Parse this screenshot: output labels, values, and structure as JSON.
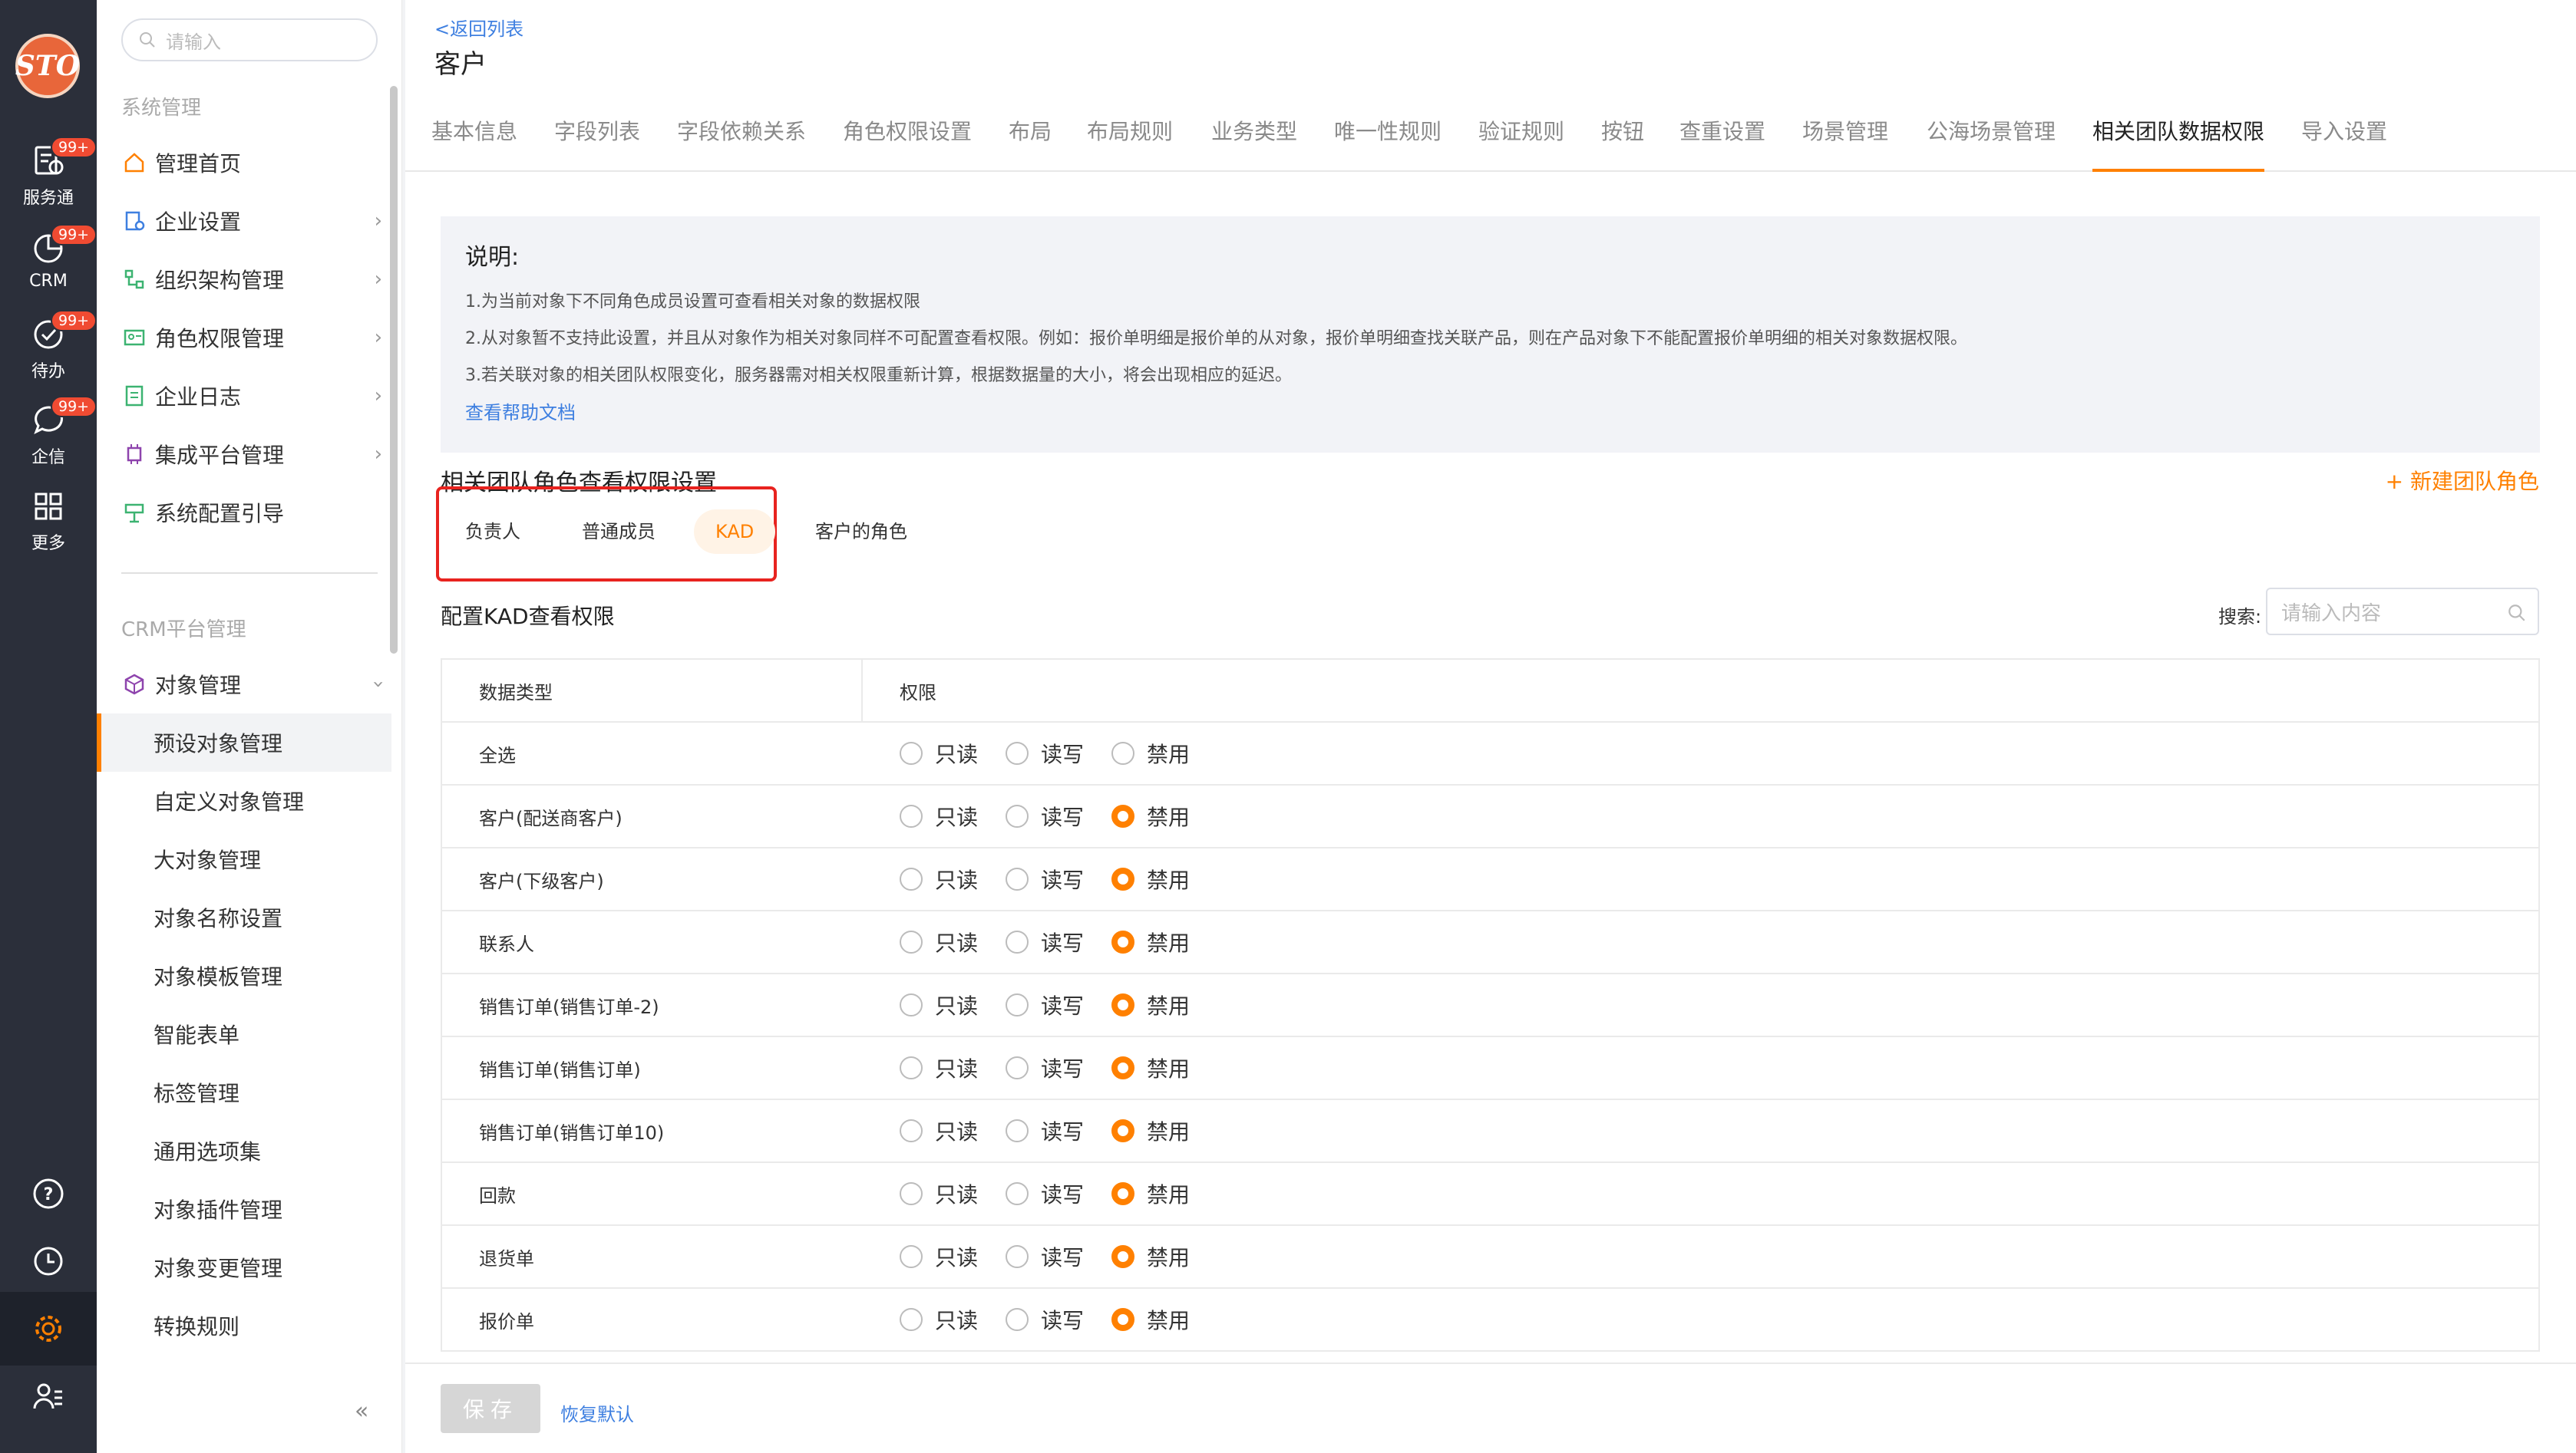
{
  "rail": {
    "logo": "STO",
    "items": [
      {
        "label": "服务通",
        "badge": "99+",
        "icon": "service-icon"
      },
      {
        "label": "CRM",
        "badge": "99+",
        "icon": "crm-icon"
      },
      {
        "label": "待办",
        "badge": "99+",
        "icon": "todo-icon"
      },
      {
        "label": "企信",
        "badge": "99+",
        "icon": "chat-icon"
      },
      {
        "label": "更多",
        "icon": "grid-icon"
      }
    ],
    "bottom": [
      "help-icon",
      "clock-icon",
      "gear-icon",
      "user-settings-icon"
    ]
  },
  "sidebar": {
    "search_placeholder": "请输入",
    "section1": "系统管理",
    "items": [
      {
        "label": "管理首页",
        "icon": "home-icon"
      },
      {
        "label": "企业设置",
        "icon": "company-icon"
      },
      {
        "label": "组织架构管理",
        "icon": "org-icon"
      },
      {
        "label": "角色权限管理",
        "icon": "role-icon"
      },
      {
        "label": "企业日志",
        "icon": "log-icon"
      },
      {
        "label": "集成平台管理",
        "icon": "chip-icon"
      },
      {
        "label": "系统配置引导",
        "icon": "guide-icon"
      }
    ],
    "section2": "CRM平台管理",
    "object_mgmt": "对象管理",
    "sub_items": [
      "预设对象管理",
      "自定义对象管理",
      "大对象管理",
      "对象名称设置",
      "对象模板管理",
      "智能表单",
      "标签管理",
      "通用选项集",
      "对象插件管理",
      "对象变更管理",
      "转换规则"
    ],
    "collapse": "«"
  },
  "header": {
    "back": "<返回列表",
    "title": "客户"
  },
  "tabs": [
    "基本信息",
    "字段列表",
    "字段依赖关系",
    "角色权限设置",
    "布局",
    "布局规则",
    "业务类型",
    "唯一性规则",
    "验证规则",
    "按钮",
    "查重设置",
    "场景管理",
    "公海场景管理",
    "相关团队数据权限",
    "导入设置"
  ],
  "note": {
    "title": "说明:",
    "lines": [
      "1.为当前对象下不同角色成员设置可查看相关对象的数据权限",
      "2.从对象暂不支持此设置，并且从对象作为相关对象同样不可配置查看权限。例如：报价单明细是报价单的从对象，报价单明细查找关联产品，则在产品对象下不能配置报价单明细的相关对象数据权限。",
      "3.若关联对象的相关团队权限变化，服务器需对相关权限重新计算，根据数据量的大小，将会出现相应的延迟。"
    ],
    "link": "查看帮助文档"
  },
  "section": {
    "title": "相关团队角色查看权限设置",
    "new_role": "+ 新建团队角色",
    "roles": [
      "负责人",
      "普通成员",
      "KAD",
      "客户的角色"
    ],
    "config_title": "配置KAD查看权限",
    "search_label": "搜索:",
    "search_placeholder": "请输入内容"
  },
  "table": {
    "headers": [
      "数据类型",
      "权限"
    ],
    "options": [
      "只读",
      "读写",
      "禁用"
    ],
    "rows": [
      {
        "type": "全选",
        "selected": -1
      },
      {
        "type": "客户(配送商客户)",
        "selected": 2
      },
      {
        "type": "客户(下级客户)",
        "selected": 2
      },
      {
        "type": "联系人",
        "selected": 2
      },
      {
        "type": "销售订单(销售订单-2)",
        "selected": 2
      },
      {
        "type": "销售订单(销售订单)",
        "selected": 2
      },
      {
        "type": "销售订单(销售订单10)",
        "selected": 2
      },
      {
        "type": "回款",
        "selected": 2
      },
      {
        "type": "退货单",
        "selected": 2
      },
      {
        "type": "报价单",
        "selected": 2
      }
    ]
  },
  "footer": {
    "save": "保存",
    "reset": "恢复默认"
  },
  "colors": {
    "accent": "#ff8000",
    "link": "#3e7fe0",
    "rail": "#2b2f3a",
    "badge": "#f04b32"
  }
}
